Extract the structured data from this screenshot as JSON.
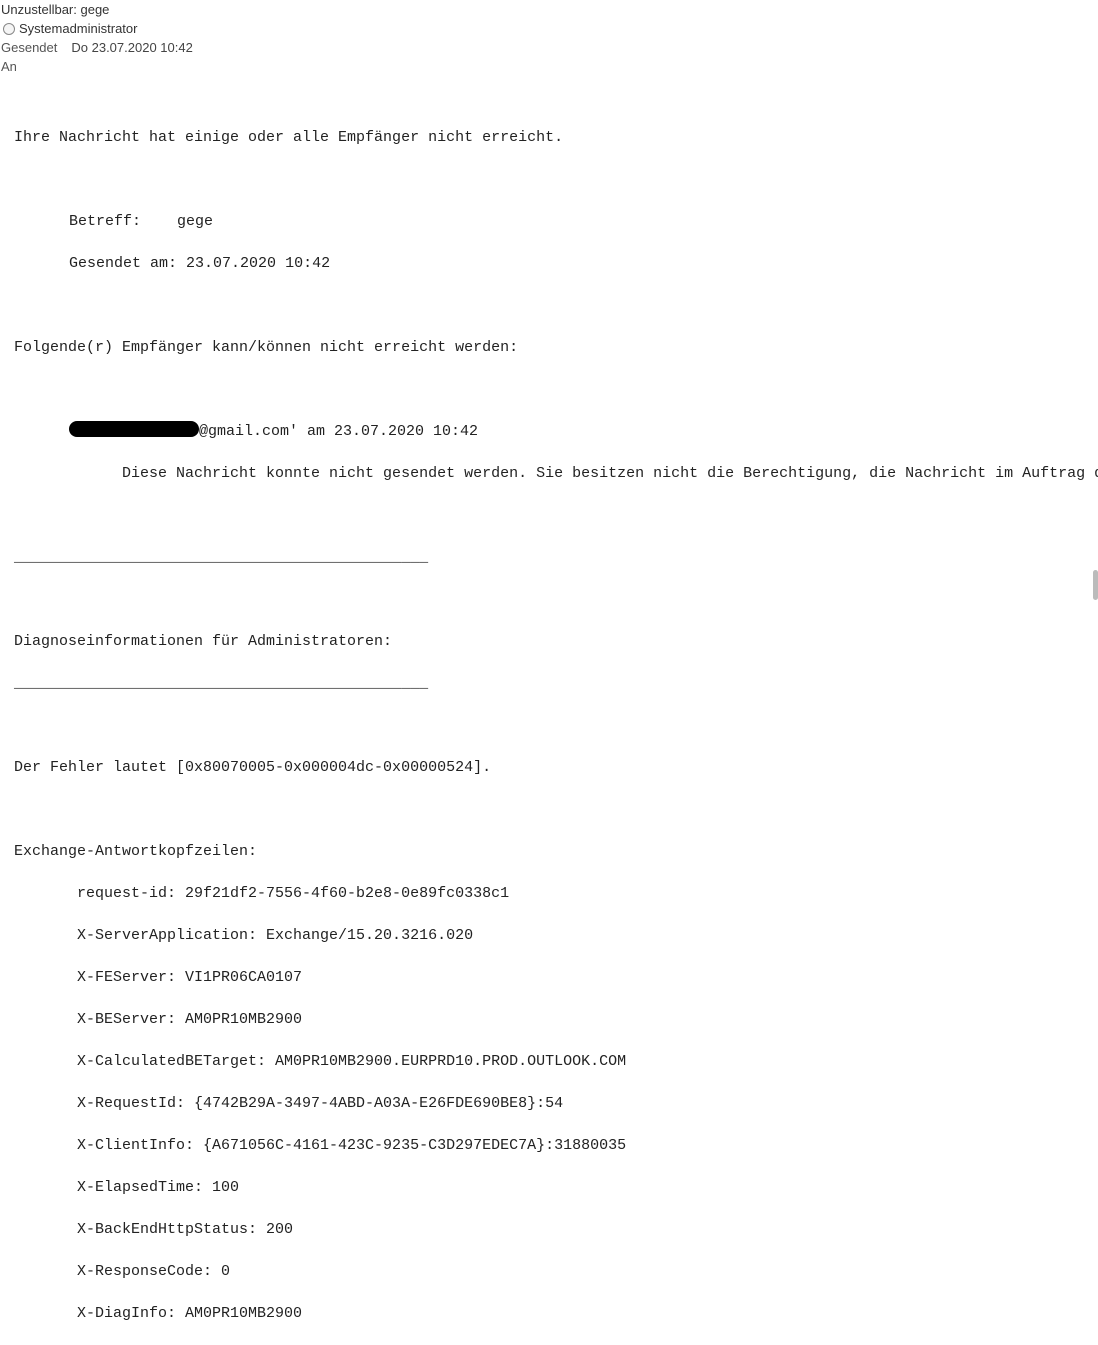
{
  "header": {
    "subject": "Unzustellbar: gege",
    "sender": "Systemadministrator",
    "sent_label": "Gesendet",
    "sent_value": "Do 23.07.2020 10:42",
    "to_label": "An"
  },
  "body": {
    "intro": "Ihre Nachricht hat einige oder alle Empfänger nicht erreicht.",
    "subject_label": "Betreff:",
    "subject_value": "gege",
    "sent_on_label": "Gesendet am:",
    "sent_on_value": "23.07.2020 10:42",
    "failed_recipients": "Folgende(r) Empfänger kann/können nicht erreicht werden:",
    "recipient_domain": "@gmail.com' am 23.07.2020 10:42",
    "error_msg": "            Diese Nachricht konnte nicht gesendet werden. Sie besitzen nicht die Berechtigung, die Nachricht im Auftrag des angegebenen Benutzers zu senden.",
    "separator": "______________________________________________",
    "diag_header": "Diagnoseinformationen für Administratoren:",
    "error_code": "Der Fehler lautet [0x80070005-0x000004dc-0x00000524].",
    "exchange_header": "Exchange-Antwortkopfzeilen:",
    "headers": {
      "request_id": "       request-id: 29f21df2-7556-4f60-b2e8-0e89fc0338c1",
      "server_app": "       X-ServerApplication: Exchange/15.20.3216.020",
      "fe_server": "       X-FEServer: VI1PR06CA0107",
      "be_server": "       X-BEServer: AM0PR10MB2900",
      "calc_target": "       X-CalculatedBETarget: AM0PR10MB2900.EURPRD10.PROD.OUTLOOK.COM",
      "request_id2": "       X-RequestId: {4742B29A-3497-4ABD-A03A-E26FDE690BE8}:54",
      "client_info": "       X-ClientInfo: {A671056C-4161-423C-9235-C3D297EDEC7A}:31880035",
      "elapsed": "       X-ElapsedTime: 100",
      "backend_status": "       X-BackEndHttpStatus: 200",
      "response_code": "       X-ResponseCode: 0",
      "diag_info": "       X-DiagInfo: AM0PR10MB2900"
    }
  }
}
